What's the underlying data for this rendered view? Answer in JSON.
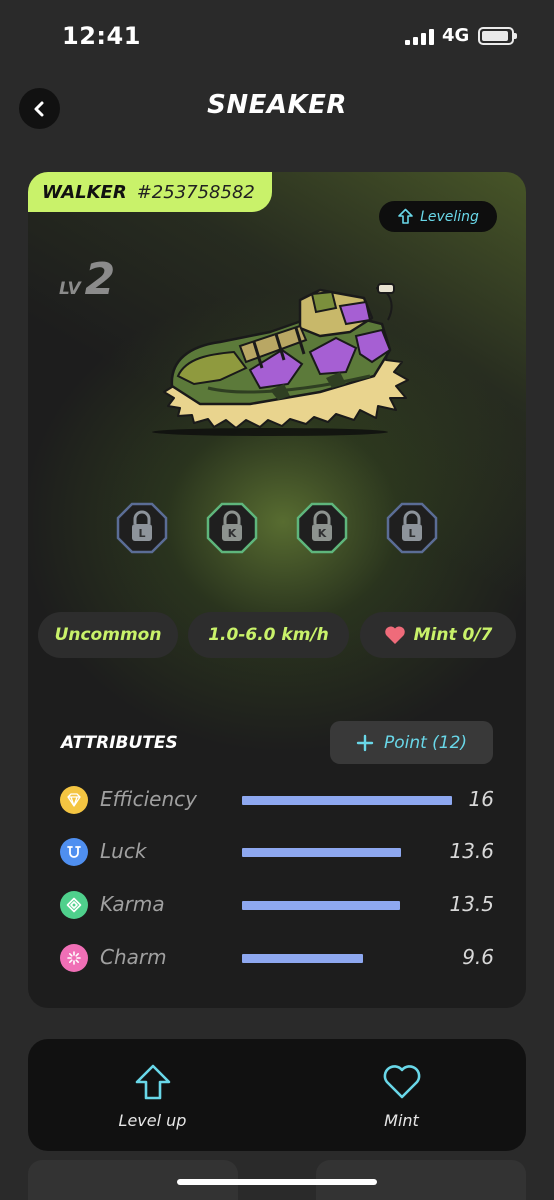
{
  "status_bar": {
    "time": "12:41",
    "network": "4G"
  },
  "header": {
    "title": "SNEAKER"
  },
  "sneaker": {
    "type": "WALKER",
    "id": "#253758582",
    "status_badge": "Leveling",
    "level_prefix": "LV",
    "level": "2",
    "sockets": [
      {
        "letter": "L",
        "color": "#5b6d96",
        "fill": "#8e949b"
      },
      {
        "letter": "K",
        "color": "#5fb67c",
        "fill": "#8d938f"
      },
      {
        "letter": "K",
        "color": "#5fb67c",
        "fill": "#8d938f"
      },
      {
        "letter": "L",
        "color": "#5b6d96",
        "fill": "#8e949b"
      }
    ],
    "rarity": "Uncommon",
    "speed": "1.0-6.0 km/h",
    "mint": "Mint 0/7"
  },
  "attributes": {
    "title": "ATTRIBUTES",
    "point_button": "Point (12)",
    "items": [
      {
        "label": "Efficiency",
        "value": "16",
        "fill": 1.0,
        "color": "#f4c542",
        "icon": "efficiency-icon"
      },
      {
        "label": "Luck",
        "value": "13.6",
        "fill": 0.755,
        "color": "#4f8ff0",
        "icon": "luck-icon"
      },
      {
        "label": "Karma",
        "value": "13.5",
        "fill": 0.75,
        "color": "#4fd08c",
        "icon": "karma-icon"
      },
      {
        "label": "Charm",
        "value": "9.6",
        "fill": 0.575,
        "color": "#f06fb6",
        "icon": "charm-icon"
      }
    ]
  },
  "actions": [
    {
      "label": "Level up",
      "icon": "level-up-icon"
    },
    {
      "label": "Mint",
      "icon": "heart-icon"
    }
  ],
  "colors": {
    "accent": "#c9f26a",
    "cyan": "#69d7e8",
    "bar": "#8ea8f0"
  }
}
